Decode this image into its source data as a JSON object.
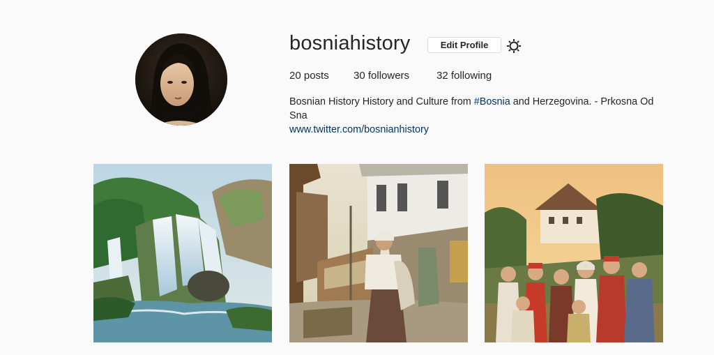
{
  "profile": {
    "username": "bosniahistory",
    "edit_profile_label": "Edit Profile",
    "settings_icon": "gear-icon",
    "stats": {
      "posts": "20 posts",
      "followers": "30 followers",
      "following": "32 following"
    },
    "bio": {
      "before_hashtag": "Bosnian History History and Culture from ",
      "hashtag": "#Bosnia",
      "after_hashtag": " and Herzegovina. - Prkosna Od Sna"
    },
    "website": "www.twitter.com/bosnianhistory"
  },
  "colors": {
    "background": "#fafafa",
    "link": "#003569",
    "text": "#262626",
    "button_border": "#dbdbdb"
  },
  "posts": [
    {
      "subject": "waterfall painting"
    },
    {
      "subject": "street scene with woman in traditional dress"
    },
    {
      "subject": "group of villagers in traditional costume before a house"
    }
  ]
}
